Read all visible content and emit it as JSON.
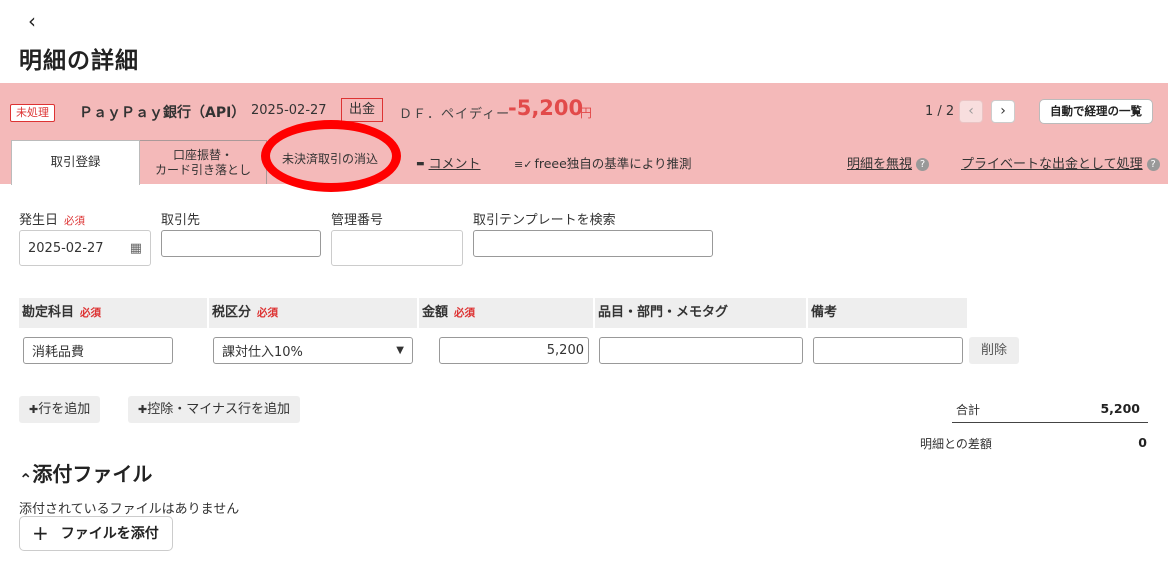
{
  "page": {
    "back_icon": "‹",
    "title": "明細の詳細"
  },
  "header": {
    "status_badge": "未処理",
    "bank_name": "ＰａｙＰａｙ銀行（API）",
    "date": "2025-02-27",
    "direction": "出金",
    "description": "ＤＦ．ペイディー",
    "amount": "-5,200",
    "currency": "円",
    "pager": "1 / 2",
    "prev_icon": "‹",
    "next_icon": "›",
    "auto_button": "自動で経理の一覧"
  },
  "tabs": [
    {
      "label": "取引登録"
    },
    {
      "line1": "口座振替・",
      "line2": "カード引き落とし"
    },
    {
      "label": "未決済取引の消込"
    }
  ],
  "actions": {
    "comment_icon": "▬",
    "comment": "コメント",
    "guess_icon": "≡✓",
    "guess": "freee独自の基準により推測",
    "ignore": "明細を無視",
    "private": "プライベートな出金として処理",
    "help_icon": "?"
  },
  "form": {
    "date_label": "発生日",
    "required": "必須",
    "date_value": "2025-02-27",
    "calendar_icon": "▦",
    "partner_label": "取引先",
    "partner_value": "",
    "manage_label": "管理番号",
    "manage_value": "",
    "template_label": "取引テンプレートを検索",
    "template_value": ""
  },
  "table": {
    "headers": [
      "勘定科目",
      "税区分",
      "金額",
      "品目・部門・メモタグ",
      "備考"
    ],
    "row": {
      "account": "消耗品費",
      "tax": "課対仕入10%",
      "amount": "5,200",
      "tags": "",
      "note": "",
      "delete": "削除"
    }
  },
  "buttons": {
    "plus_icon": "✚",
    "add_row": "行を追加",
    "add_deduction": "控除・マイナス行を追加"
  },
  "summary": {
    "total_label": "合計",
    "total_value": "5,200",
    "diff_label": "明細との差額",
    "diff_value": "0"
  },
  "attachments": {
    "caret_icon": "⌃",
    "title": "添付ファイル",
    "empty": "添付されているファイルはありません",
    "plus_icon": "+",
    "add_button": "ファイルを添付"
  }
}
